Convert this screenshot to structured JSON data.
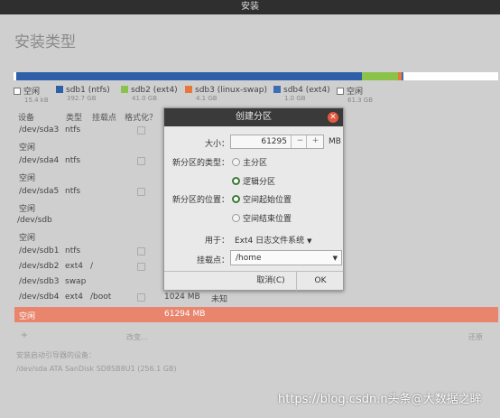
{
  "window": {
    "title": "安装"
  },
  "page_title": "安装类型",
  "legend": [
    {
      "name": "空闲",
      "size": "15.4 kB",
      "color": "#ffffff"
    },
    {
      "name": "sdb1 (ntfs)",
      "size": "392.7 GB",
      "color": "#2f5fa8"
    },
    {
      "name": "sdb2 (ext4)",
      "size": "41.0 GB",
      "color": "#8bc34a"
    },
    {
      "name": "sdb3 (linux-swap)",
      "size": "4.1 GB",
      "color": "#e9773a"
    },
    {
      "name": "sdb4 (ext4)",
      "size": "1.0 GB",
      "color": "#3e6db5"
    },
    {
      "name": "空闲",
      "size": "61.3 GB",
      "color": "#ffffff"
    }
  ],
  "table": {
    "headers": [
      "设备",
      "类型",
      "挂载点",
      "格式化？"
    ],
    "rows": [
      {
        "device": "/dev/sda3",
        "type": "ntfs",
        "mount": "",
        "size": "",
        "used": ""
      },
      {
        "device": "空闲",
        "type": "",
        "mount": "",
        "size": "",
        "used": ""
      },
      {
        "device": "/dev/sda4",
        "type": "ntfs",
        "mount": "",
        "size": "",
        "used": ""
      },
      {
        "device": "空闲",
        "type": "",
        "mount": "",
        "size": "",
        "used": ""
      },
      {
        "device": "/dev/sda5",
        "type": "ntfs",
        "mount": "",
        "size": "",
        "used": ""
      },
      {
        "device": "空闲",
        "type": "",
        "mount": "",
        "size": "",
        "used": ""
      },
      {
        "device": "/dev/sdb",
        "type": "",
        "mount": "",
        "size": "",
        "used": ""
      },
      {
        "device": "空闲",
        "type": "",
        "mount": "",
        "size": "",
        "used": ""
      },
      {
        "device": "/dev/sdb1",
        "type": "ntfs",
        "mount": "",
        "size": "",
        "used": ""
      },
      {
        "device": "/dev/sdb2",
        "type": "ext4",
        "mount": "/",
        "size": "",
        "used": ""
      },
      {
        "device": "/dev/sdb3",
        "type": "swap",
        "mount": "",
        "size": "",
        "used": ""
      },
      {
        "device": "/dev/sdb4",
        "type": "ext4",
        "mount": "/boot",
        "size": "1024 MB",
        "used": "未知"
      },
      {
        "device": "空闲",
        "type": "",
        "mount": "",
        "size": "61294 MB",
        "used": ""
      }
    ],
    "selected_row": 12,
    "add_label": "+",
    "change_label": "改变...",
    "restore_label": "还原"
  },
  "bootloader": {
    "label": "安装启动引导器的设备：",
    "device": "/dev/sda   ATA SanDisk SD8SB8U1 (256.1 GB)"
  },
  "dialog": {
    "title": "创建分区",
    "size_label": "大小：",
    "size_value": "61295",
    "size_minus": "−",
    "size_plus": "+",
    "size_unit": "MB",
    "type_label": "新分区的类型：",
    "type_primary": "主分区",
    "type_logical": "逻辑分区",
    "location_label": "新分区的位置：",
    "location_start": "空间起始位置",
    "location_end": "空间结束位置",
    "use_label": "用于：",
    "use_value": "Ext4 日志文件系统",
    "mount_label": "挂载点：",
    "mount_value": "/home",
    "cancel_label": "取消(C)",
    "ok_label": "OK"
  },
  "watermark": "https://blog.csdn.n头条@大数据之眸"
}
